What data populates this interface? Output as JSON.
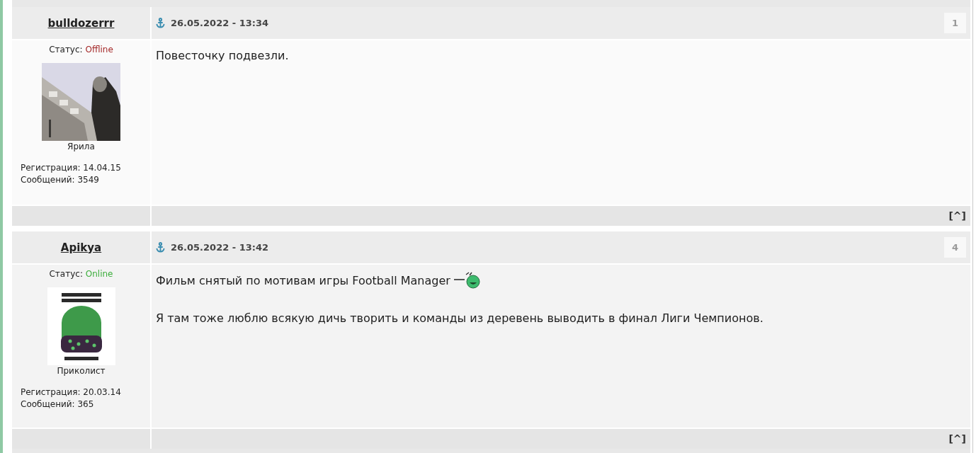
{
  "posts": [
    {
      "author": "bulldozerrr",
      "status_label": "Статус:",
      "status": "Offline",
      "online": false,
      "avatar": {
        "kind": "picture"
      },
      "rank": "Ярила",
      "registered": "Регистрация: 14.04.15",
      "messages": "Сообщений: 3549",
      "date": "26.05.2022 - 13:34",
      "number": "1",
      "paragraphs": [
        {
          "text": "Повесточку подвезли.",
          "smiley": false
        }
      ],
      "top_link": "[^]"
    },
    {
      "author": "Apikya",
      "status_label": "Статус:",
      "status": "Online",
      "online": true,
      "avatar": {
        "kind": "picture"
      },
      "rank": "Приколист",
      "registered": "Регистрация: 20.03.14",
      "messages": "Сообщений: 365",
      "date": "26.05.2022 - 13:42",
      "number": "4",
      "paragraphs": [
        {
          "text": "Фильм снятый по мотивам игры Football Manager",
          "smiley": true
        },
        {
          "text": "Я там тоже люблю всякую дичь творить и команды из деревень выводить в финал Лиги Чемпионов.",
          "smiley": false
        }
      ],
      "top_link": "[^]"
    }
  ]
}
